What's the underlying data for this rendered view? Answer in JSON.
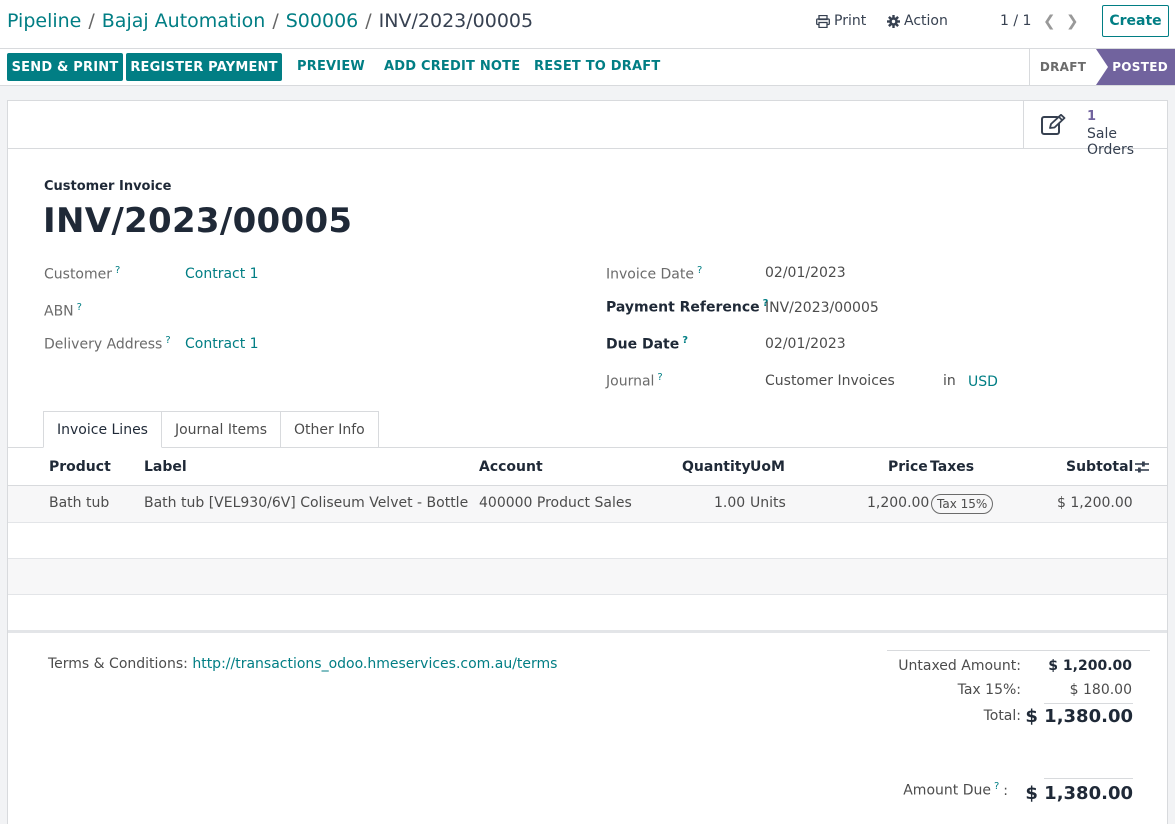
{
  "breadcrumb": {
    "items": [
      "Pipeline",
      "Bajaj Automation",
      "S00006"
    ],
    "separator": "/",
    "current": "INV/2023/00005"
  },
  "toolbar": {
    "print": "Print",
    "action": "Action",
    "pager": "1 / 1",
    "create": "Create"
  },
  "buttons": {
    "send_print": "SEND & PRINT",
    "register_payment": "REGISTER PAYMENT",
    "preview": "PREVIEW",
    "add_credit_note": "ADD CREDIT NOTE",
    "reset_to_draft": "RESET TO DRAFT"
  },
  "status": {
    "draft": "DRAFT",
    "posted": "POSTED"
  },
  "smart_button": {
    "count": "1",
    "label": "Sale Orders"
  },
  "invoice": {
    "type": "Customer Invoice",
    "name": "INV/2023/00005"
  },
  "fields": {
    "customer_label": "Customer",
    "customer": "Contract 1",
    "abn_label": "ABN",
    "delivery_label": "Delivery Address",
    "delivery": "Contract 1",
    "invoice_date_label": "Invoice Date",
    "invoice_date": "02/01/2023",
    "payment_ref_label": "Payment Reference",
    "payment_ref": "INV/2023/00005",
    "due_date_label": "Due Date",
    "due_date": "02/01/2023",
    "journal_label": "Journal",
    "journal": "Customer Invoices",
    "in": "in",
    "currency": "USD",
    "hint": "?"
  },
  "tabs": [
    "Invoice Lines",
    "Journal Items",
    "Other Info"
  ],
  "table": {
    "headers": {
      "product": "Product",
      "label": "Label",
      "account": "Account",
      "quantity": "Quantity",
      "uom": "UoM",
      "price": "Price",
      "taxes": "Taxes",
      "subtotal": "Subtotal"
    },
    "rows": [
      {
        "product": "Bath tub",
        "label": "Bath tub [VEL930/6V] Coliseum Velvet - Bottle",
        "account": "400000 Product Sales",
        "quantity": "1.00",
        "uom": "Units",
        "price": "1,200.00",
        "tax": "Tax 15%",
        "subtotal": "$ 1,200.00"
      }
    ]
  },
  "terms": {
    "label": "Terms & Conditions:",
    "url": "http://transactions_odoo.hmeservices.com.au/terms"
  },
  "totals": {
    "untaxed_label": "Untaxed Amount:",
    "untaxed": "$ 1,200.00",
    "tax_label": "Tax 15%:",
    "tax": "$ 180.00",
    "total_label": "Total:",
    "total": "$ 1,380.00",
    "due_label": "Amount Due",
    "due_colon": ":",
    "due": "$ 1,380.00"
  },
  "colors": {
    "primary": "#017e84",
    "posted": "#71639e"
  }
}
